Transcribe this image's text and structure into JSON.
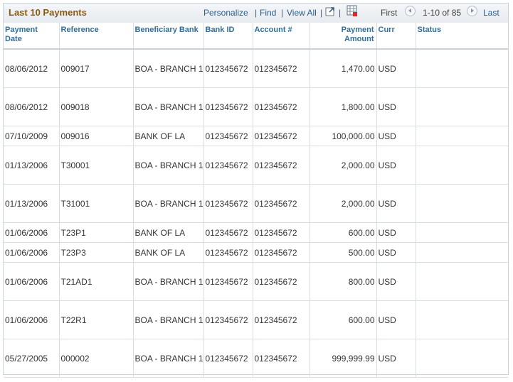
{
  "grid": {
    "title": "Last 10 Payments",
    "toolbar": {
      "personalize": "Personalize",
      "separator": "|",
      "find": "Find",
      "view_all": "View All",
      "first": "First",
      "range": "1-10 of 85",
      "last": "Last"
    },
    "icons": [
      "new-window-icon",
      "download-spreadsheet-icon",
      "previous-arrow-icon",
      "next-arrow-icon"
    ],
    "columns": {
      "date": [
        "Payment",
        "Date"
      ],
      "reference": "Reference",
      "bank": "Beneficiary Bank",
      "bank_id": "Bank ID",
      "account": "Account #",
      "amount": [
        "Payment",
        "Amount"
      ],
      "curr": "Curr",
      "status": "Status"
    },
    "rows": [
      {
        "date": "08/06/2012",
        "reference": "009017",
        "bank": "BOA - BRANCH 1",
        "bank_id": "012345672",
        "account": "012345672",
        "amount": "1,470.00",
        "curr": "USD",
        "status": ""
      },
      {
        "date": "08/06/2012",
        "reference": "009018",
        "bank": "BOA - BRANCH 1",
        "bank_id": "012345672",
        "account": "012345672",
        "amount": "1,800.00",
        "curr": "USD",
        "status": ""
      },
      {
        "date": "07/10/2009",
        "reference": "009016",
        "bank": "BANK OF LA",
        "bank_id": "012345672",
        "account": "012345672",
        "amount": "100,000.00",
        "curr": "USD",
        "status": ""
      },
      {
        "date": "01/13/2006",
        "reference": "T30001",
        "bank": "BOA - BRANCH 1",
        "bank_id": "012345672",
        "account": "012345672",
        "amount": "2,000.00",
        "curr": "USD",
        "status": ""
      },
      {
        "date": "01/13/2006",
        "reference": "T31001",
        "bank": "BOA - BRANCH 1",
        "bank_id": "012345672",
        "account": "012345672",
        "amount": "2,000.00",
        "curr": "USD",
        "status": ""
      },
      {
        "date": "01/06/2006",
        "reference": "T23P1",
        "bank": "BANK OF LA",
        "bank_id": "012345672",
        "account": "012345672",
        "amount": "600.00",
        "curr": "USD",
        "status": ""
      },
      {
        "date": "01/06/2006",
        "reference": "T23P3",
        "bank": "BANK OF LA",
        "bank_id": "012345672",
        "account": "012345672",
        "amount": "500.00",
        "curr": "USD",
        "status": ""
      },
      {
        "date": "01/06/2006",
        "reference": "T21AD1",
        "bank": "BOA - BRANCH 1",
        "bank_id": "012345672",
        "account": "012345672",
        "amount": "800.00",
        "curr": "USD",
        "status": ""
      },
      {
        "date": "01/06/2006",
        "reference": "T22R1",
        "bank": "BOA - BRANCH 1",
        "bank_id": "012345672",
        "account": "012345672",
        "amount": "600.00",
        "curr": "USD",
        "status": ""
      },
      {
        "date": "05/27/2005",
        "reference": "000002",
        "bank": "BOA - BRANCH 1",
        "bank_id": "012345672",
        "account": "012345672",
        "amount": "999,999.99",
        "curr": "USD",
        "status": ""
      }
    ]
  }
}
